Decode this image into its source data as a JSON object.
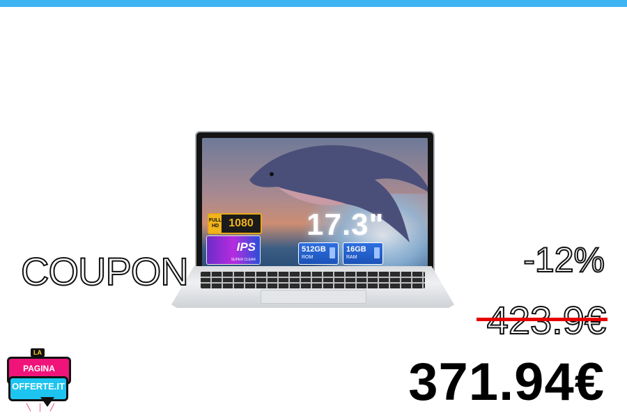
{
  "product": {
    "screen_size": "17.3\"",
    "badges": {
      "fullhd_label": "FULL HD",
      "resolution": "1080",
      "panel": "IPS",
      "panel_sub": "SUPER CLEAR",
      "storage_value": "512GB",
      "storage_label": "ROM",
      "memory_value": "16GB",
      "memory_label": "RAM"
    }
  },
  "promo": {
    "coupon_label": "COUPON",
    "discount": "-12%",
    "old_price": "423.9€",
    "new_price": "371.94€"
  },
  "logo": {
    "top": "LA",
    "line1": "PAGINA DELLE",
    "line2": "OFFERTE.IT"
  },
  "colors": {
    "top_bar": "#3fb4f2",
    "strike": "#e60000",
    "logo_pink": "#f0147a",
    "logo_cyan": "#1ec4f0"
  }
}
